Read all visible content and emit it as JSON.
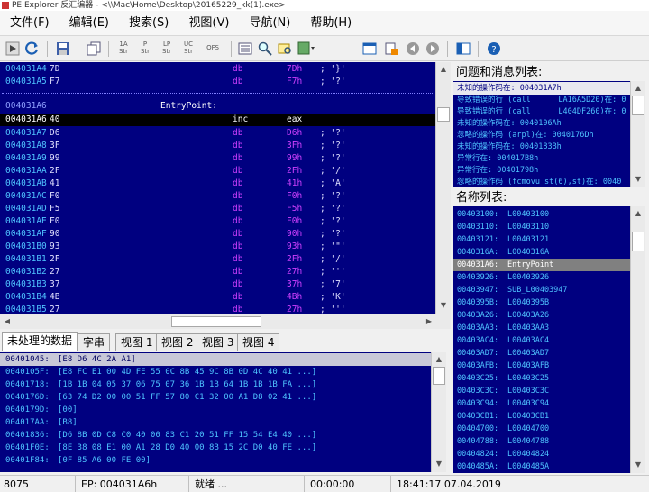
{
  "window": {
    "title": "PE Explorer 反汇编器 - <\\\\Mac\\Home\\Desktop\\20165229_kk(1).exe>"
  },
  "menu": [
    "文件(F)",
    "编辑(E)",
    "搜索(S)",
    "视图(V)",
    "导航(N)",
    "帮助(H)"
  ],
  "toolbar": {
    "text_buttons": [
      {
        "top": "1A",
        "bottom": "Str"
      },
      {
        "top": "P",
        "bottom": "Str"
      },
      {
        "top": "LP",
        "bottom": "Str"
      },
      {
        "top": "UC",
        "bottom": "Str"
      }
    ],
    "ofs_label": "OFS"
  },
  "disasm": {
    "rows_top": [
      {
        "addr": "004031A4",
        "byte": "7D",
        "mn": "db",
        "op": "7Dh",
        "cm": "; '}'"
      },
      {
        "addr": "004031A5",
        "byte": "F7",
        "mn": "db",
        "op": "F7h",
        "cm": "; '?'"
      }
    ],
    "label_addr": "004031A6",
    "label_name": "EntryPoint:",
    "selected": {
      "addr": "004031A6",
      "byte": "40",
      "mn": "inc",
      "op": "eax"
    },
    "rows": [
      {
        "addr": "004031A7",
        "byte": "D6",
        "mn": "db",
        "op": "D6h",
        "cm": "; '?'"
      },
      {
        "addr": "004031A8",
        "byte": "3F",
        "mn": "db",
        "op": "3Fh",
        "cm": "; '?'"
      },
      {
        "addr": "004031A9",
        "byte": "99",
        "mn": "db",
        "op": "99h",
        "cm": "; '?'"
      },
      {
        "addr": "004031AA",
        "byte": "2F",
        "mn": "db",
        "op": "2Fh",
        "cm": "; '/'"
      },
      {
        "addr": "004031AB",
        "byte": "41",
        "mn": "db",
        "op": "41h",
        "cm": "; 'A'"
      },
      {
        "addr": "004031AC",
        "byte": "F0",
        "mn": "db",
        "op": "F0h",
        "cm": "; '?'"
      },
      {
        "addr": "004031AD",
        "byte": "F5",
        "mn": "db",
        "op": "F5h",
        "cm": "; '?'"
      },
      {
        "addr": "004031AE",
        "byte": "F0",
        "mn": "db",
        "op": "F0h",
        "cm": "; '?'"
      },
      {
        "addr": "004031AF",
        "byte": "90",
        "mn": "db",
        "op": "90h",
        "cm": "; '?'"
      },
      {
        "addr": "004031B0",
        "byte": "93",
        "mn": "db",
        "op": "93h",
        "cm": "; '\"'"
      },
      {
        "addr": "004031B1",
        "byte": "2F",
        "mn": "db",
        "op": "2Fh",
        "cm": "; '/'"
      },
      {
        "addr": "004031B2",
        "byte": "27",
        "mn": "db",
        "op": "27h",
        "cm": "; '''"
      },
      {
        "addr": "004031B3",
        "byte": "37",
        "mn": "db",
        "op": "37h",
        "cm": "; '7'"
      },
      {
        "addr": "004031B4",
        "byte": "4B",
        "mn": "db",
        "op": "4Bh",
        "cm": "; 'K'"
      },
      {
        "addr": "004031B5",
        "byte": "27",
        "mn": "db",
        "op": "27h",
        "cm": "; '''"
      }
    ]
  },
  "tabs": [
    "未处理的数据",
    "字串",
    "视图 1",
    "视图 2",
    "视图 3",
    "视图 4"
  ],
  "raw": [
    {
      "addr": "00401045:",
      "bytes": "[E8 D6 4C 2A A1]"
    },
    {
      "addr": "0040105F:",
      "bytes": "[E8 FC E1 00 4D FE 55 0C 8B 45 9C 8B 0D 4C 40 41 ...]"
    },
    {
      "addr": "00401718:",
      "bytes": "[1B 1B 04 05 37 06 75 07 36 1B 1B 64 1B 1B 1B FA ...]"
    },
    {
      "addr": "0040176D:",
      "bytes": "[63 74 D2 00 00 51 FF 57 80 C1 32 00 A1 D8 02 41 ...]"
    },
    {
      "addr": "0040179D:",
      "bytes": "[00]"
    },
    {
      "addr": "004017AA:",
      "bytes": "[B8]"
    },
    {
      "addr": "00401836:",
      "bytes": "[D6 8B 0D C8 C0 40 00 83 C1 20 51 FF 15 54 E4 40 ...]"
    },
    {
      "addr": "00401F0E:",
      "bytes": "[8E 38 08 E1 00 A1 28 D0 40 00 8B 15 2C D0 40 FE ...]"
    },
    {
      "addr": "00401F84:",
      "bytes": "[0F 85 A6 00 FE 00]"
    }
  ],
  "issues": {
    "header": "问题和消息列表:",
    "items": [
      "未知的操作码在: 004031A7h",
      "导致错误的行 (call      LA16A5D20)在: 0",
      "导致错误的行 (call      L404DF260)在: 0",
      "未知的操作码在: 0040106Ah",
      "忽略的操作码 (arpl)在: 0040176Dh",
      "未知的操作码在: 0040183Bh",
      "异常行在: 004017B8h",
      "异常行在: 00401798h",
      "忽略的操作码 (fcmovu st(6),st)在: 0040"
    ]
  },
  "names": {
    "header": "名称列表:",
    "items": [
      {
        "addr": "00403100:",
        "name": "L00403100"
      },
      {
        "addr": "00403110:",
        "name": "L00403110"
      },
      {
        "addr": "00403121:",
        "name": "L00403121"
      },
      {
        "addr": "0040316A:",
        "name": "L0040316A"
      },
      {
        "addr": "004031A6:",
        "name": "EntryPoint"
      },
      {
        "addr": "00403926:",
        "name": "L00403926"
      },
      {
        "addr": "00403947:",
        "name": "SUB_L00403947"
      },
      {
        "addr": "0040395B:",
        "name": "L0040395B"
      },
      {
        "addr": "00403A26:",
        "name": "L00403A26"
      },
      {
        "addr": "00403AA3:",
        "name": "L00403AA3"
      },
      {
        "addr": "00403AC4:",
        "name": "L00403AC4"
      },
      {
        "addr": "00403AD7:",
        "name": "L00403AD7"
      },
      {
        "addr": "00403AFB:",
        "name": "L00403AFB"
      },
      {
        "addr": "00403C25:",
        "name": "L00403C25"
      },
      {
        "addr": "00403C3C:",
        "name": "L00403C3C"
      },
      {
        "addr": "00403C94:",
        "name": "L00403C94"
      },
      {
        "addr": "00403CB1:",
        "name": "L00403CB1"
      },
      {
        "addr": "00404700:",
        "name": "L00404700"
      },
      {
        "addr": "00404788:",
        "name": "L00404788"
      },
      {
        "addr": "00404824:",
        "name": "L00404824"
      },
      {
        "addr": "0040485A:",
        "name": "L0040485A"
      }
    ]
  },
  "status": {
    "left": "8075",
    "ep": "EP: 004031A6h",
    "state": "就绪 ...",
    "time": "00:00:00",
    "datetime": "18:41:17 07.04.2019"
  }
}
